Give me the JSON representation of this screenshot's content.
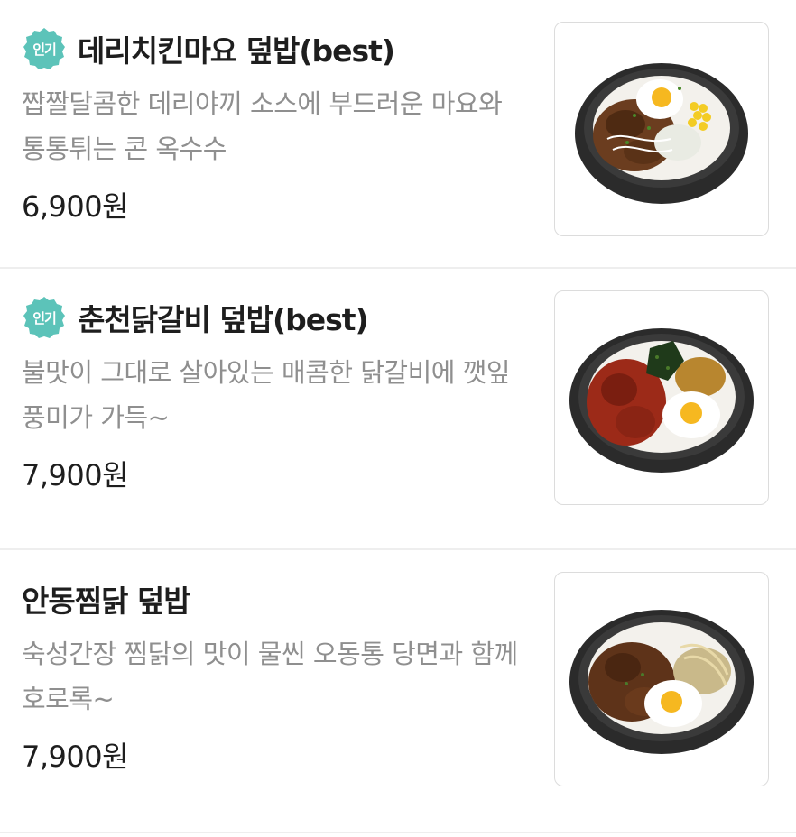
{
  "menu": {
    "items": [
      {
        "badge": "인기",
        "name": "데리치킨마요 덮밥(best)",
        "description": "짭짤달콤한 데리야끼 소스에 부드러운 마요와 통통튀는 콘 옥수수",
        "price": "6,900원",
        "image": "teriyaki-chicken-mayo-rice-bowl"
      },
      {
        "badge": "인기",
        "name": "춘천닭갈비 덮밥(best)",
        "description": "불맛이 그대로 살아있는 매콤한 닭갈비에 깻잎 풍미가 가득~",
        "price": "7,900원",
        "image": "chuncheon-dakgalbi-rice-bowl"
      },
      {
        "badge": "",
        "name": "안동찜닭 덮밥",
        "description": "숙성간장 찜닭의 맛이 물씬 오동통 당면과 함께 호로록~",
        "price": "7,900원",
        "image": "andong-jjimdak-rice-bowl"
      }
    ]
  },
  "colors": {
    "badge": "#5cc3b9",
    "title": "#1e1e1e",
    "description": "#8f8f8f",
    "divider": "#eeeeee"
  }
}
